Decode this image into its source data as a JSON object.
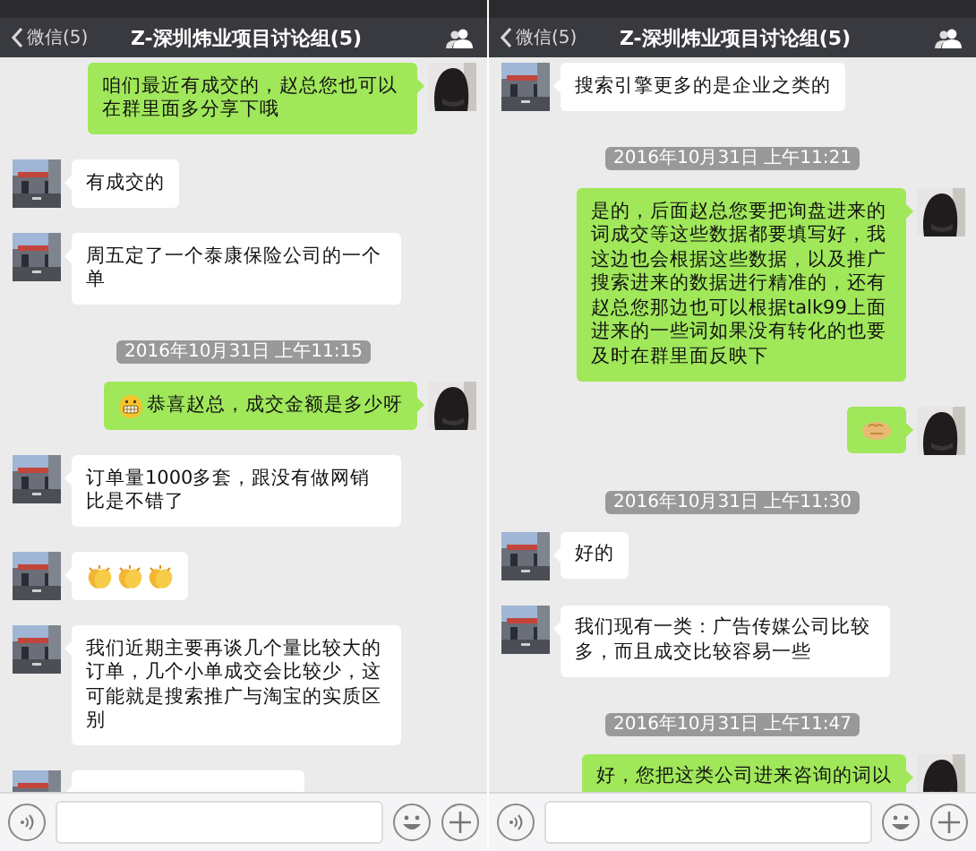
{
  "panels": [
    {
      "nav": {
        "back": "微信(5)",
        "title": "Z-深圳炜业项目讨论组(5)"
      },
      "messages": [
        {
          "kind": "text",
          "outgoing": true,
          "text": "咱们最近有成交的，赵总您也可以在群里面多分享下哦"
        },
        {
          "kind": "text",
          "outgoing": false,
          "text": "有成交的"
        },
        {
          "kind": "text",
          "outgoing": false,
          "text": "周五定了一个泰康保险公司的一个单"
        },
        {
          "kind": "time",
          "text": "2016年10月31日 上午11:15"
        },
        {
          "kind": "text",
          "outgoing": true,
          "emoji": {
            "kind": "grimace"
          },
          "text": "恭喜赵总，成交金额是多少呀"
        },
        {
          "kind": "text",
          "outgoing": false,
          "text": "订单量1000多套，跟没有做网销比是不错了"
        },
        {
          "kind": "emoji",
          "outgoing": false,
          "emojis": [
            {
              "kind": "clap"
            },
            {
              "kind": "clap"
            },
            {
              "kind": "clap"
            }
          ]
        },
        {
          "kind": "text",
          "outgoing": false,
          "text": "我们近期主要再谈几个量比较大的订单，几个小单成交会比较少，这可能就是搜索推广与淘宝的实质区别"
        },
        {
          "kind": "cut",
          "outgoing": false
        }
      ]
    },
    {
      "nav": {
        "back": "微信(5)",
        "title": "Z-深圳炜业项目讨论组(5)"
      },
      "messages": [
        {
          "kind": "text",
          "outgoing": false,
          "text": "搜索引擎更多的是企业之类的"
        },
        {
          "kind": "time",
          "text": "2016年10月31日 上午11:21"
        },
        {
          "kind": "text",
          "outgoing": true,
          "text": "是的，后面赵总您要把询盘进来的词成交等这些数据都要填写好，我这边也会根据这些数据，以及推广搜索进来的数据进行精准的，还有赵总您那边也可以根据talk99上面进来的一些词如果没有转化的也要及时在群里面反映下"
        },
        {
          "kind": "emoji",
          "outgoing": true,
          "emojis": [
            {
              "kind": "bump"
            }
          ]
        },
        {
          "kind": "time",
          "text": "2016年10月31日 上午11:30"
        },
        {
          "kind": "text",
          "outgoing": false,
          "text": "好的"
        },
        {
          "kind": "text",
          "outgoing": false,
          "text": "我们现有一类：广告传媒公司比较多，而且成交比较容易一些"
        },
        {
          "kind": "time",
          "text": "2016年10月31日 上午11:47"
        },
        {
          "kind": "text",
          "outgoing": true,
          "text": "好，您把这类公司进来咨询的词以"
        }
      ]
    }
  ]
}
